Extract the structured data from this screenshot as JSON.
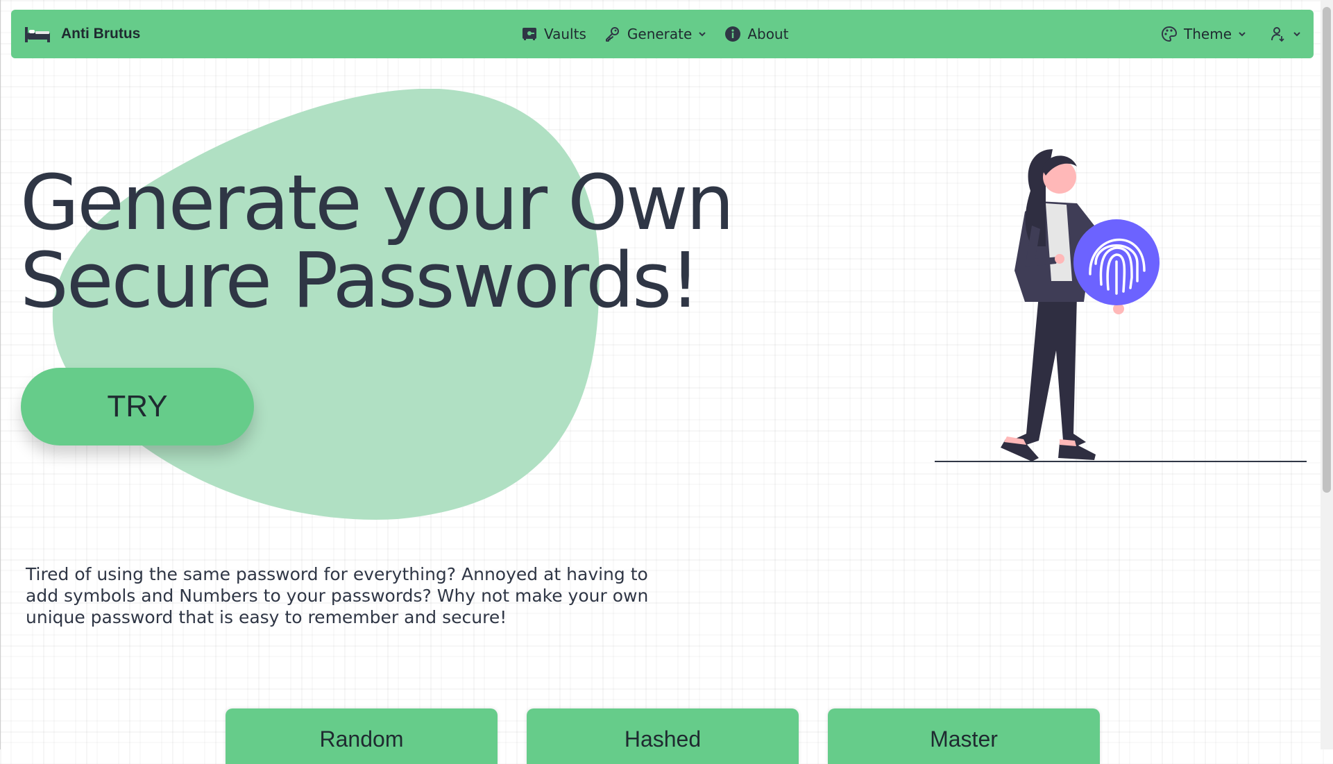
{
  "brand": {
    "name": "Anti Brutus",
    "logo_icon": "bed-icon"
  },
  "nav": {
    "vaults": "Vaults",
    "generate": "Generate",
    "about": "About",
    "theme": "Theme"
  },
  "hero": {
    "title": "Generate your Own Secure Passwords!",
    "cta": "TRY",
    "description": "Tired of using the same password for everything? Annoyed at having to add symbols and Numbers to your passwords? Why not make your own unique password that is easy to remember and secure!"
  },
  "cards": [
    {
      "label": "Random"
    },
    {
      "label": "Hashed"
    },
    {
      "label": "Master"
    }
  ],
  "colors": {
    "accent": "#66cc8a",
    "blob": "#b0e0c3",
    "text": "#2f3645",
    "fingerprint": "#6c63ff"
  }
}
